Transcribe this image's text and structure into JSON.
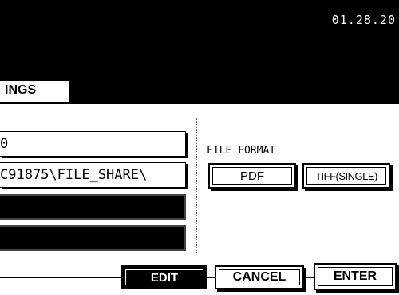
{
  "header": {
    "clock": "01.28.20"
  },
  "tab": {
    "label": "INGS"
  },
  "fields": {
    "row1": "0",
    "row2": "C91875\\FILE_SHARE\\",
    "row3": "",
    "row4": ""
  },
  "file_format": {
    "label": "FILE FORMAT",
    "pdf_label": "PDF",
    "tiff_label": "TIFF(SINGLE)"
  },
  "actions": {
    "edit_label": "EDIT",
    "cancel_label": "CANCEL",
    "enter_label": "ENTER"
  },
  "colors": {
    "screen_bg": "#000000",
    "panel_bg": "#ffffff",
    "text": "#000000"
  }
}
